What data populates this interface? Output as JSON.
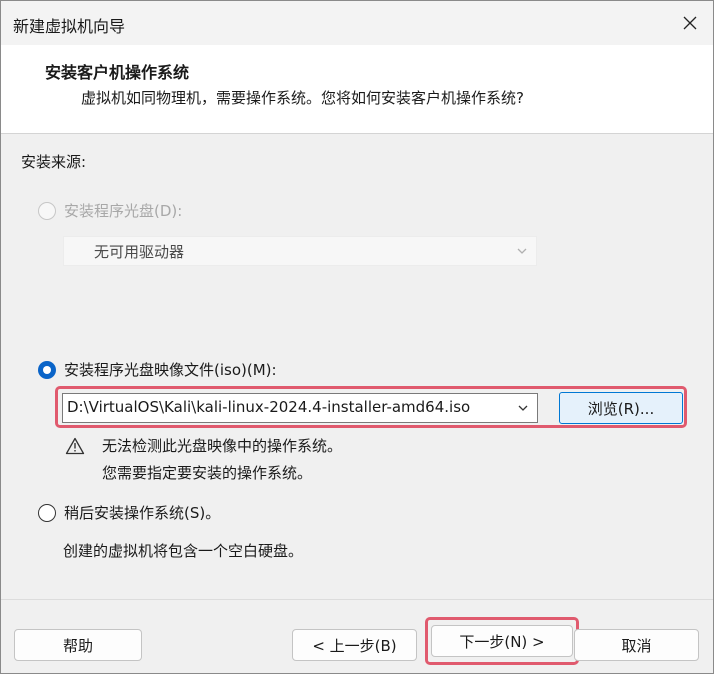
{
  "window": {
    "title": "新建虚拟机向导"
  },
  "header": {
    "title": "安装客户机操作系统",
    "subtitle": "虚拟机如同物理机，需要操作系统。您将如何安装客户机操作系统?"
  },
  "install_source": {
    "label": "安装来源:",
    "options": [
      {
        "label": "安装程序光盘(D):",
        "selected": false,
        "enabled": false
      },
      {
        "label": "安装程序光盘映像文件(iso)(M):",
        "selected": true,
        "enabled": true
      },
      {
        "label": "稍后安装操作系统(S)。",
        "selected": false,
        "enabled": true
      }
    ],
    "drive_select": {
      "value": "无可用驱动器"
    },
    "iso_path": {
      "value": "D:\\VirtualOS\\Kali\\kali-linux-2024.4-installer-amd64.iso"
    },
    "browse_label": "浏览(R)...",
    "warning_line1": "无法检测此光盘映像中的操作系统。",
    "warning_line2": "您需要指定要安装的操作系统。",
    "later_description": "创建的虚拟机将包含一个空白硬盘。"
  },
  "footer": {
    "help_label": "帮助",
    "back_label": "< 上一步(B)",
    "next_label": "下一步(N) >",
    "cancel_label": "取消"
  },
  "colors": {
    "accent": "#0a64c8",
    "highlight": "#e05a6e"
  }
}
